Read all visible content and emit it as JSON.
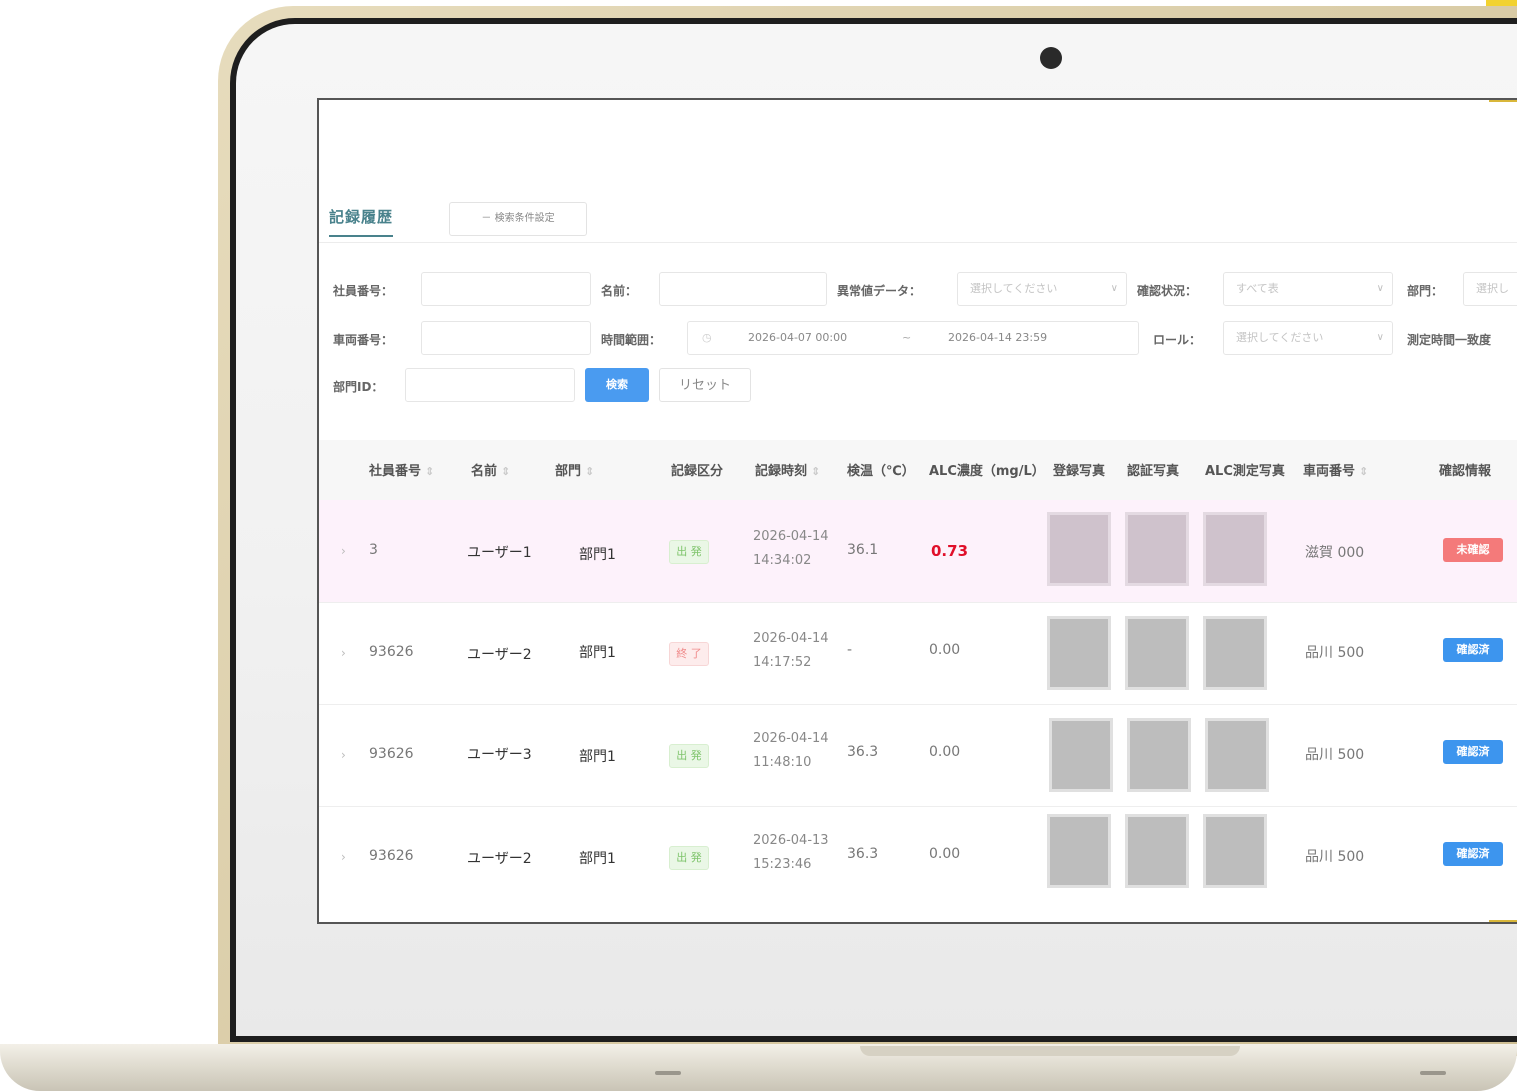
{
  "page": {
    "tab_active": "記録履歴",
    "filter_toggle": "－ 検索条件設定"
  },
  "filters": {
    "employee_no_label": "社員番号：",
    "name_label": "名前：",
    "anomaly_label": "異常値データ：",
    "anomaly_placeholder": "選択してください",
    "confirm_status_label": "確認状況：",
    "confirm_status_value": "すべて表",
    "department_label": "部門：",
    "department_placeholder": "選択し",
    "vehicle_no_label": "車両番号：",
    "time_range_label": "時間範囲：",
    "time_start": "2026-04-07 00:00",
    "time_separator": "~",
    "time_end": "2026-04-14 23:59",
    "role_label": "ロール：",
    "role_placeholder": "選択してください",
    "measure_match_label": "測定時間一致度",
    "dept_id_label": "部門ID：",
    "search_button": "検索",
    "reset_button": "リセット"
  },
  "table": {
    "columns": [
      "社員番号",
      "名前",
      "部門",
      "記録区分",
      "記録時刻",
      "検温（℃）",
      "ALC濃度（mg/L）",
      "登録写真",
      "認証写真",
      "ALC測定写真",
      "車両番号",
      "確認情報"
    ],
    "rows": [
      {
        "employee_no": "3",
        "name": "ユーザー1",
        "department": "部門1",
        "record_type": "出 発",
        "date": "2026-04-14",
        "time": "14:34:02",
        "temp": "36.1",
        "alc": "0.73",
        "vehicle": "滋賀 000",
        "status": "未確認"
      },
      {
        "employee_no": "93626",
        "name": "ユーザー2",
        "department": "部門1",
        "record_type": "終 了",
        "date": "2026-04-14",
        "time": "14:17:52",
        "temp": "-",
        "alc": "0.00",
        "vehicle": "品川 500",
        "status": "確認済"
      },
      {
        "employee_no": "93626",
        "name": "ユーザー3",
        "department": "部門1",
        "record_type": "出 発",
        "date": "2026-04-14",
        "time": "11:48:10",
        "temp": "36.3",
        "alc": "0.00",
        "vehicle": "品川 500",
        "status": "確認済"
      },
      {
        "employee_no": "93626",
        "name": "ユーザー2",
        "department": "部門1",
        "record_type": "出 発",
        "date": "2026-04-13",
        "time": "15:23:46",
        "temp": "36.3",
        "alc": "0.00",
        "vehicle": "品川 500",
        "status": "確認済"
      }
    ]
  },
  "colors": {
    "accent": "#49828c",
    "primary_button": "#4a9bf0",
    "alert_text": "#e0102a",
    "pending_badge": "#f47a7a",
    "done_badge": "#3d95ee"
  }
}
